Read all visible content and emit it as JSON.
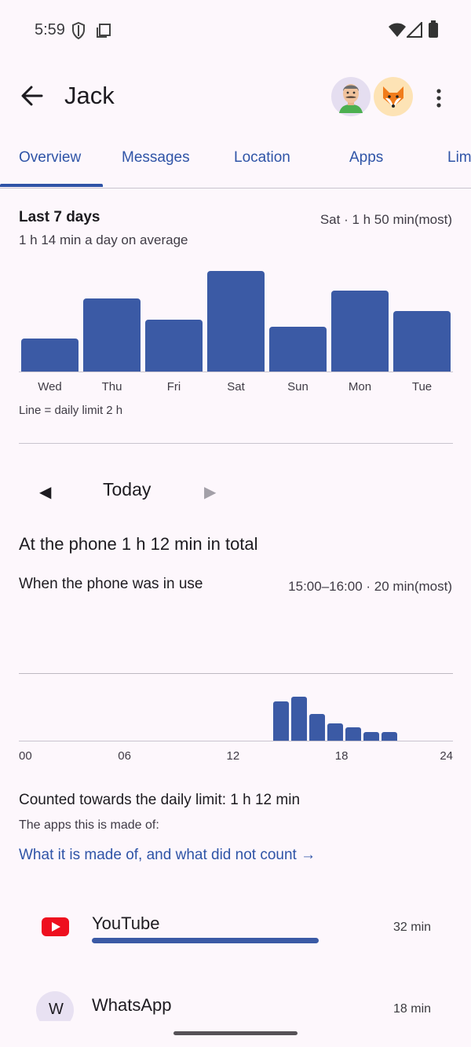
{
  "status_bar": {
    "time": "5:59"
  },
  "header": {
    "title": "Jack"
  },
  "tabs": [
    {
      "label": "Overview",
      "selected": true
    },
    {
      "label": "Messages"
    },
    {
      "label": "Location"
    },
    {
      "label": "Apps"
    },
    {
      "label": "Lim"
    }
  ],
  "week": {
    "heading": "Last 7 days",
    "subheading": "1 h 14 min a day on average",
    "most": "Sat · 1 h 50 min(most)",
    "note": "Line = daily limit 2 h"
  },
  "day_nav": {
    "label": "Today",
    "prev": "◀",
    "next": "▶"
  },
  "today": {
    "total": "At the phone 1 h 12 min in total",
    "usage_heading": "When the phone was in use",
    "most": "15:00–16:00 · 20 min(most)"
  },
  "limit": {
    "heading": "Counted towards the daily limit: 1 h 12 min",
    "subtext": "The apps this is made of:",
    "link": "What it is made of, and what did not count →"
  },
  "apps": [
    {
      "name": "YouTube",
      "time": "32 min",
      "usage_fraction": 0.8,
      "icon": "youtube-icon",
      "color": "#ee0f1e"
    },
    {
      "name": "WhatsApp",
      "time": "18 min",
      "icon_letter": "W"
    }
  ],
  "chart_data": [
    {
      "type": "bar",
      "categories": [
        "Wed",
        "Thu",
        "Fri",
        "Sat",
        "Sun",
        "Mon",
        "Tue"
      ],
      "values": [
        36,
        80,
        57,
        110,
        49,
        88,
        66
      ],
      "ylabel": "minutes",
      "ylim": [
        0,
        120
      ]
    },
    {
      "type": "bar",
      "x_ticks": [
        "00",
        "06",
        "12",
        "18",
        "24"
      ],
      "hours": [
        14,
        15,
        16,
        17,
        18,
        19,
        20
      ],
      "values": [
        18,
        20,
        12,
        8,
        6,
        4,
        4
      ],
      "ylabel": "minutes",
      "ylim": [
        0,
        30
      ]
    }
  ]
}
